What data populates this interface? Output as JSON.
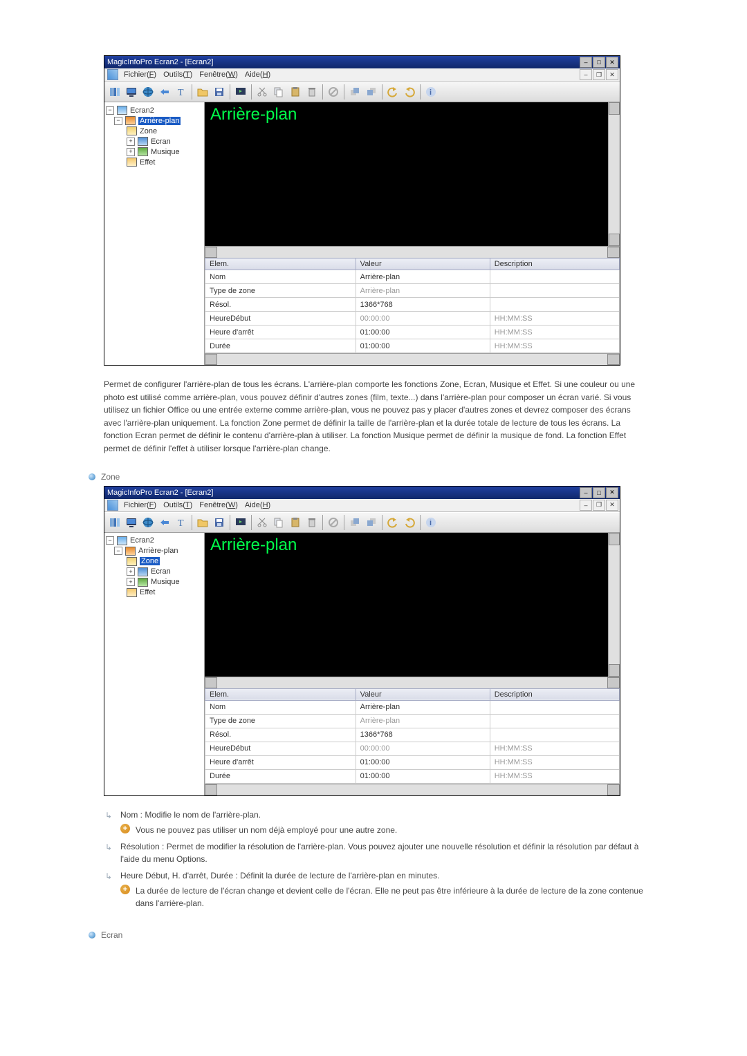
{
  "doc": {
    "body_text": "Permet de configurer l'arrière-plan de tous les écrans. L'arrière-plan comporte les fonctions Zone, Ecran, Musique et Effet. Si une couleur ou une photo est utilisé comme arrière-plan, vous pouvez définir d'autres zones (film, texte...) dans l'arrière-plan pour composer un écran varié. Si vous utilisez un fichier Office ou une entrée externe comme arrière-plan, vous ne pouvez pas y placer d'autres zones et devrez composer des écrans avec l'arrière-plan uniquement. La fonction Zone permet de définir la taille de l'arrière-plan et la durée totale de lecture de tous les écrans. La fonction Ecran permet de définir le contenu d'arrière-plan à utiliser. La fonction Musique permet de définir la musique de fond. La fonction Effet permet de définir l'effet à utiliser lorsque l'arrière-plan change.",
    "section_zone_title": "Zone",
    "section_ecran_title": "Ecran",
    "notes": {
      "n1": "Nom : Modifie le nom de l'arrière-plan.",
      "n1_sub": "Vous ne pouvez pas utiliser un nom déjà employé pour une autre zone.",
      "n2": "Résolution : Permet de modifier la résolution de l'arrière-plan. Vous pouvez ajouter une nouvelle résolution et définir la résolution par défaut à l'aide du menu Options.",
      "n3": "Heure Début, H. d'arrêt, Durée : Définit la durée de lecture de l'arrière-plan en minutes.",
      "n3_sub": "La durée de lecture de l'écran change et devient celle de l'écran. Elle ne peut pas être inférieure à la durée de lecture de la zone contenue dans l'arrière-plan."
    }
  },
  "app_common": {
    "window_title": "MagicInfoPro Ecran2 - [Ecran2]",
    "menus": {
      "file_pre": "Fichier(",
      "file_u": "F",
      "file_post": ")",
      "tools_pre": "Outils(",
      "tools_u": "T",
      "tools_post": ")",
      "window_pre": "Fenêtre(",
      "window_u": "W",
      "window_post": ")",
      "help_pre": "Aide(",
      "help_u": "H",
      "help_post": ")"
    },
    "preview_title": "Arrière-plan",
    "tree": {
      "root": "Ecran2",
      "bg": "Arrière-plan",
      "zone": "Zone",
      "ecran": "Ecran",
      "music": "Musique",
      "effect": "Effet"
    },
    "grid": {
      "headers": {
        "elem": "Elem.",
        "valeur": "Valeur",
        "desc": "Description"
      },
      "rows": {
        "nom_l": "Nom",
        "nom_v": "Arrière-plan",
        "type_l": "Type de zone",
        "type_v": "Arrière-plan",
        "resol_l": "Résol.",
        "resol_v": "1366*768",
        "hdebut_l": "HeureDébut",
        "hdebut_v": "00:00:00",
        "hdebut_d": "HH:MM:SS",
        "harret_l": "Heure d'arrêt",
        "harret_v": "01:00:00",
        "harret_d": "HH:MM:SS",
        "duree_l": "Durée",
        "duree_v": "01:00:00",
        "duree_d": "HH:MM:SS"
      }
    }
  },
  "app1": {
    "tree_selected": "bg"
  },
  "app2": {
    "tree_selected": "zone"
  }
}
